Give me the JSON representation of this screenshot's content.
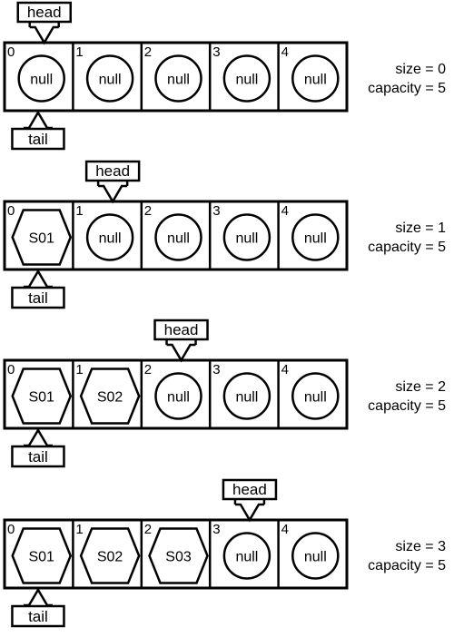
{
  "diagram": {
    "type": "circular-array-queue",
    "pointer_labels": {
      "head": "head",
      "tail": "tail"
    },
    "null_label": "null",
    "states": [
      {
        "cells": [
          {
            "index": "0",
            "value": null
          },
          {
            "index": "1",
            "value": null
          },
          {
            "index": "2",
            "value": null
          },
          {
            "index": "3",
            "value": null
          },
          {
            "index": "4",
            "value": null
          }
        ],
        "head": 0,
        "tail": 0,
        "size_text": "size = 0",
        "capacity_text": "capacity = 5"
      },
      {
        "cells": [
          {
            "index": "0",
            "value": "S01"
          },
          {
            "index": "1",
            "value": null
          },
          {
            "index": "2",
            "value": null
          },
          {
            "index": "3",
            "value": null
          },
          {
            "index": "4",
            "value": null
          }
        ],
        "head": 1,
        "tail": 0,
        "size_text": "size = 1",
        "capacity_text": "capacity = 5"
      },
      {
        "cells": [
          {
            "index": "0",
            "value": "S01"
          },
          {
            "index": "1",
            "value": "S02"
          },
          {
            "index": "2",
            "value": null
          },
          {
            "index": "3",
            "value": null
          },
          {
            "index": "4",
            "value": null
          }
        ],
        "head": 2,
        "tail": 0,
        "size_text": "size = 2",
        "capacity_text": "capacity = 5"
      },
      {
        "cells": [
          {
            "index": "0",
            "value": "S01"
          },
          {
            "index": "1",
            "value": "S02"
          },
          {
            "index": "2",
            "value": "S03"
          },
          {
            "index": "3",
            "value": null
          },
          {
            "index": "4",
            "value": null
          }
        ],
        "head": 3,
        "tail": 0,
        "size_text": "size = 3",
        "capacity_text": "capacity = 5"
      }
    ]
  }
}
